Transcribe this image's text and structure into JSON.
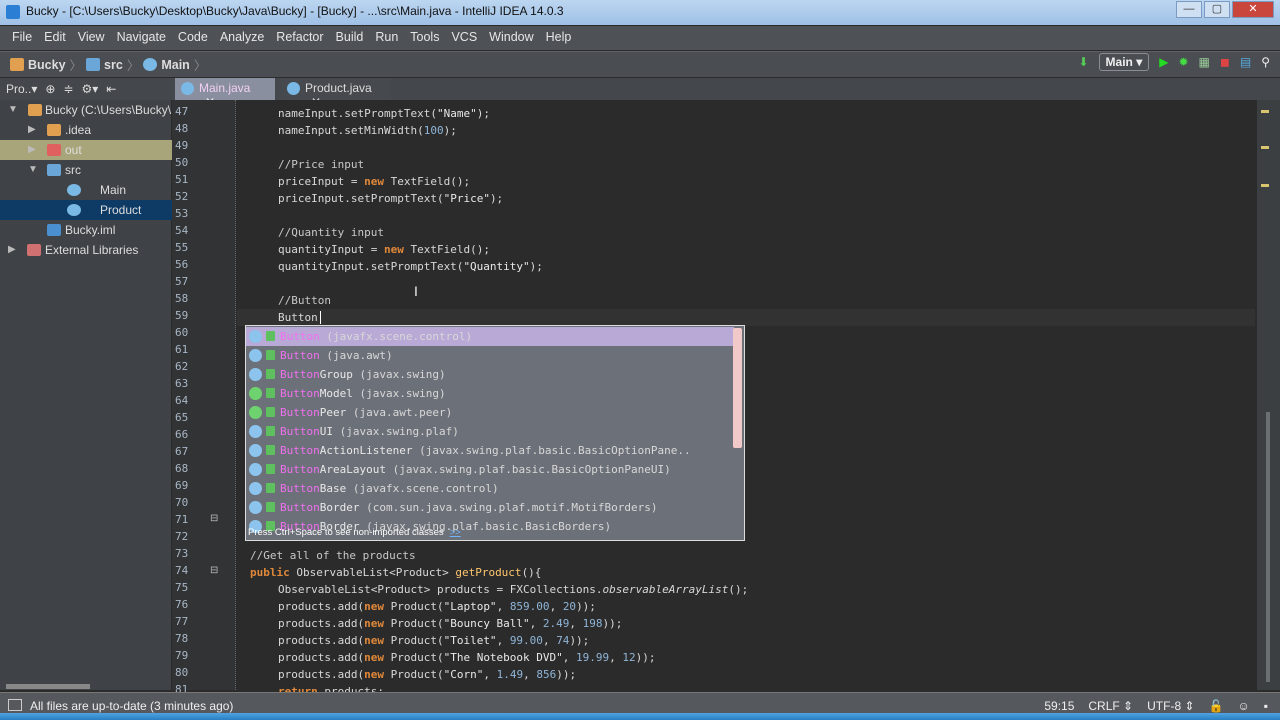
{
  "window": {
    "title": "Bucky - [C:\\Users\\Bucky\\Desktop\\Bucky\\Java\\Bucky] - [Bucky] - ...\\src\\Main.java - IntelliJ IDEA 14.0.3",
    "buttons": [
      "—",
      "▢",
      "✕"
    ]
  },
  "menu": [
    "File",
    "Edit",
    "View",
    "Navigate",
    "Code",
    "Analyze",
    "Refactor",
    "Build",
    "Run",
    "Tools",
    "VCS",
    "Window",
    "Help"
  ],
  "breadcrumb": [
    "Bucky",
    "src",
    "Main"
  ],
  "toolbar": {
    "run_config": "Main ▾",
    "icons": [
      "make-icon",
      "run-icon",
      "debug-icon",
      "coverage-icon",
      "stop-icon",
      "project-structure-icon",
      "search-icon"
    ]
  },
  "project_panel": {
    "label": "Pro..▾"
  },
  "tabs": [
    {
      "label": "Main.java",
      "close": "✕"
    },
    {
      "label": "Product.java",
      "close": "✕"
    }
  ],
  "tree": [
    {
      "label": "Bucky (C:\\Users\\Bucky\\Desktop\\Bucky\\Java\\Bucky)",
      "arrow": "▼"
    },
    {
      "label": ".idea",
      "arrow": "▶"
    },
    {
      "label": "out",
      "arrow": "▶"
    },
    {
      "label": "src",
      "arrow": "▼"
    },
    {
      "label": "Main",
      "arrow": ""
    },
    {
      "label": "Product",
      "arrow": ""
    },
    {
      "label": "Bucky.iml",
      "arrow": ""
    },
    {
      "label": "External Libraries",
      "arrow": "▶"
    }
  ],
  "line_numbers": [
    "47",
    "48",
    "49",
    "50",
    "51",
    "52",
    "53",
    "54",
    "55",
    "56",
    "57",
    "58",
    "59",
    "60",
    "61",
    "62",
    "63",
    "64",
    "65",
    "66",
    "67",
    "68",
    "69",
    "70",
    "71",
    "72",
    "73",
    "74",
    "75",
    "76",
    "77",
    "78",
    "79",
    "80",
    "81"
  ],
  "code": [
    {
      "n": 47,
      "ind": 2,
      "segs": [
        [
          "",
          "nameInput.setPromptText("
        ],
        [
          "s",
          "\"Name\""
        ],
        [
          "",
          ");"
        ]
      ]
    },
    {
      "n": 48,
      "ind": 2,
      "segs": [
        [
          "",
          "nameInput.setMinWidth("
        ],
        [
          "n",
          "100"
        ],
        [
          "",
          ");"
        ]
      ]
    },
    {
      "n": 50,
      "ind": 2,
      "segs": [
        [
          "c",
          "//Price input"
        ]
      ]
    },
    {
      "n": 51,
      "ind": 2,
      "segs": [
        [
          "",
          "priceInput = "
        ],
        [
          "k",
          "new"
        ],
        [
          "",
          " TextField();"
        ]
      ]
    },
    {
      "n": 52,
      "ind": 2,
      "segs": [
        [
          "",
          "priceInput.setPromptText("
        ],
        [
          "s",
          "\"Price\""
        ],
        [
          "",
          ");"
        ]
      ]
    },
    {
      "n": 54,
      "ind": 2,
      "segs": [
        [
          "c",
          "//Quantity input"
        ]
      ]
    },
    {
      "n": 55,
      "ind": 2,
      "segs": [
        [
          "",
          "quantityInput = "
        ],
        [
          "k",
          "new"
        ],
        [
          "",
          " TextField();"
        ]
      ]
    },
    {
      "n": 56,
      "ind": 2,
      "segs": [
        [
          "",
          "quantityInput.setPromptText("
        ],
        [
          "s",
          "\"Quantity\""
        ],
        [
          "",
          ");"
        ]
      ]
    },
    {
      "n": 58,
      "ind": 2,
      "segs": [
        [
          "c",
          "//Button"
        ]
      ]
    },
    {
      "n": 59,
      "ind": 2,
      "segs": [
        [
          "",
          "Button"
        ]
      ]
    },
    {
      "n": 73,
      "ind": 1,
      "segs": [
        [
          "c",
          "//Get all of the products"
        ]
      ]
    },
    {
      "n": 74,
      "ind": 1,
      "segs": [
        [
          "k",
          "public"
        ],
        [
          "",
          " ObservableList<Product> "
        ],
        [
          "m",
          "getProduct"
        ],
        [
          "",
          "(){"
        ]
      ]
    },
    {
      "n": 75,
      "ind": 2,
      "segs": [
        [
          "",
          "ObservableList<Product> products = FXCollections."
        ],
        [
          "i",
          "observableArrayList"
        ],
        [
          "",
          "();"
        ]
      ]
    },
    {
      "n": 76,
      "ind": 2,
      "segs": [
        [
          "",
          "products.add("
        ],
        [
          "k",
          "new"
        ],
        [
          "",
          " Product("
        ],
        [
          "s",
          "\"Laptop\""
        ],
        [
          "",
          ", "
        ],
        [
          "n",
          "859.00"
        ],
        [
          "",
          ", "
        ],
        [
          "n",
          "20"
        ],
        [
          "",
          "));"
        ]
      ]
    },
    {
      "n": 77,
      "ind": 2,
      "segs": [
        [
          "",
          "products.add("
        ],
        [
          "k",
          "new"
        ],
        [
          "",
          " Product("
        ],
        [
          "s",
          "\"Bouncy Ball\""
        ],
        [
          "",
          ", "
        ],
        [
          "n",
          "2.49"
        ],
        [
          "",
          ", "
        ],
        [
          "n",
          "198"
        ],
        [
          "",
          "));"
        ]
      ]
    },
    {
      "n": 78,
      "ind": 2,
      "segs": [
        [
          "",
          "products.add("
        ],
        [
          "k",
          "new"
        ],
        [
          "",
          " Product("
        ],
        [
          "s",
          "\"Toilet\""
        ],
        [
          "",
          ", "
        ],
        [
          "n",
          "99.00"
        ],
        [
          "",
          ", "
        ],
        [
          "n",
          "74"
        ],
        [
          "",
          "));"
        ]
      ]
    },
    {
      "n": 79,
      "ind": 2,
      "segs": [
        [
          "",
          "products.add("
        ],
        [
          "k",
          "new"
        ],
        [
          "",
          " Product("
        ],
        [
          "s",
          "\"The Notebook DVD\""
        ],
        [
          "",
          ", "
        ],
        [
          "n",
          "19.99"
        ],
        [
          "",
          ", "
        ],
        [
          "n",
          "12"
        ],
        [
          "",
          "));"
        ]
      ]
    },
    {
      "n": 80,
      "ind": 2,
      "segs": [
        [
          "",
          "products.add("
        ],
        [
          "k",
          "new"
        ],
        [
          "",
          " Product("
        ],
        [
          "s",
          "\"Corn\""
        ],
        [
          "",
          ", "
        ],
        [
          "n",
          "1.49"
        ],
        [
          "",
          ", "
        ],
        [
          "n",
          "856"
        ],
        [
          "",
          "));"
        ]
      ]
    },
    {
      "n": 81,
      "ind": 2,
      "segs": [
        [
          "k",
          "return"
        ],
        [
          "",
          " products;"
        ]
      ]
    }
  ],
  "completion": {
    "items": [
      {
        "hl": "Button",
        "rest": "",
        "pkg": "(javafx.scene.control)",
        "icon": "b"
      },
      {
        "hl": "Button",
        "rest": "",
        "pkg": "(java.awt)",
        "icon": "b"
      },
      {
        "hl": "Button",
        "rest": "Group",
        "pkg": "(javax.swing)",
        "icon": "b"
      },
      {
        "hl": "Button",
        "rest": "Model",
        "pkg": "(javax.swing)",
        "icon": "g"
      },
      {
        "hl": "Button",
        "rest": "Peer",
        "pkg": "(java.awt.peer)",
        "icon": "g"
      },
      {
        "hl": "Button",
        "rest": "UI",
        "pkg": "(javax.swing.plaf)",
        "icon": "b"
      },
      {
        "hl": "Button",
        "rest": "ActionListener",
        "pkg": "(javax.swing.plaf.basic.BasicOptionPane..",
        "icon": "b"
      },
      {
        "hl": "Button",
        "rest": "AreaLayout",
        "pkg": "(javax.swing.plaf.basic.BasicOptionPaneUI)",
        "icon": "b"
      },
      {
        "hl": "Button",
        "rest": "Base",
        "pkg": "(javafx.scene.control)",
        "icon": "b"
      },
      {
        "hl": "Button",
        "rest": "Border",
        "pkg": "(com.sun.java.swing.plaf.motif.MotifBorders)",
        "icon": "b"
      },
      {
        "hl": "Button",
        "rest": "Border",
        "pkg": "(javax.swing.plaf.basic.BasicBorders)",
        "icon": "b"
      }
    ],
    "hint": "Press Ctrl+Space to see non-imported classes",
    "hint_link": ">>"
  },
  "status": {
    "message": "All files are up-to-date (3 minutes ago)",
    "position": "59:15",
    "line_sep": "CRLF ⇕",
    "encoding": "UTF-8 ⇕"
  }
}
